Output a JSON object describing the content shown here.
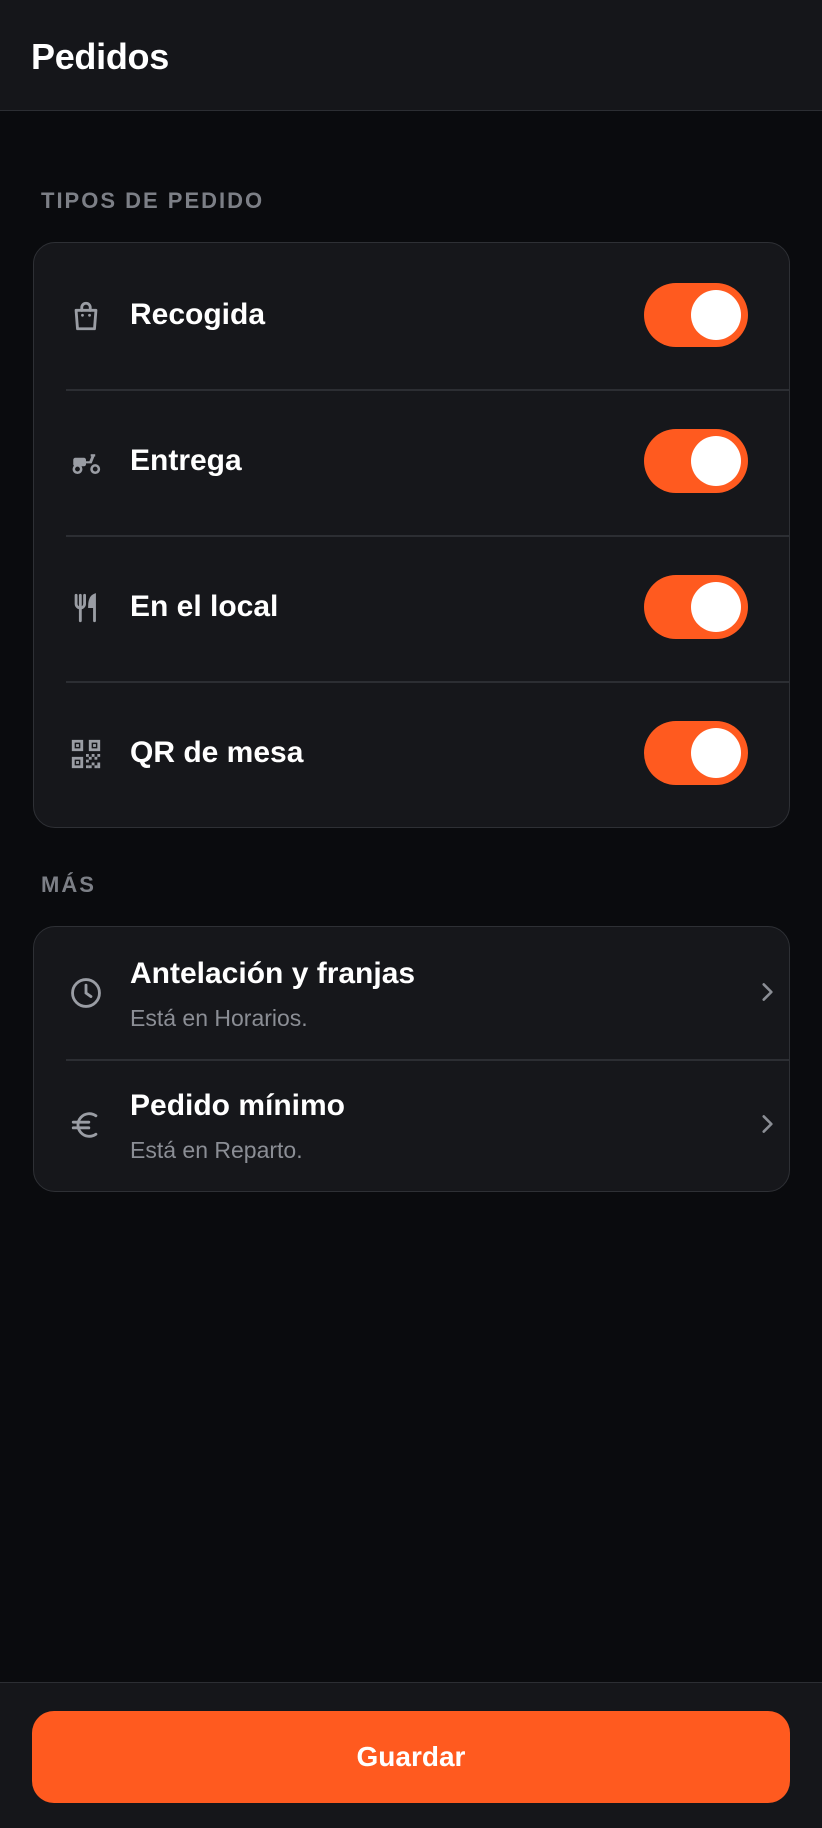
{
  "header": {
    "title": "Pedidos"
  },
  "sections": {
    "order_types_label": "TIPOS DE PEDIDO",
    "more_label": "MÁS"
  },
  "order_types": [
    {
      "label": "Recogida",
      "icon": "shopping-bag-icon",
      "enabled": true
    },
    {
      "label": "Entrega",
      "icon": "scooter-icon",
      "enabled": true
    },
    {
      "label": "En el local",
      "icon": "utensils-icon",
      "enabled": true
    },
    {
      "label": "QR de mesa",
      "icon": "qr-code-icon",
      "enabled": true
    }
  ],
  "more_items": [
    {
      "title": "Antelación y franjas",
      "subtitle": "Está en Horarios.",
      "icon": "clock-icon"
    },
    {
      "title": "Pedido mínimo",
      "subtitle": "Está en Reparto.",
      "icon": "euro-icon"
    }
  ],
  "footer": {
    "save_label": "Guardar"
  },
  "colors": {
    "accent": "#ff5a1f",
    "background": "#0a0b0e",
    "card": "#16171b",
    "muted_text": "#8b8e95"
  }
}
